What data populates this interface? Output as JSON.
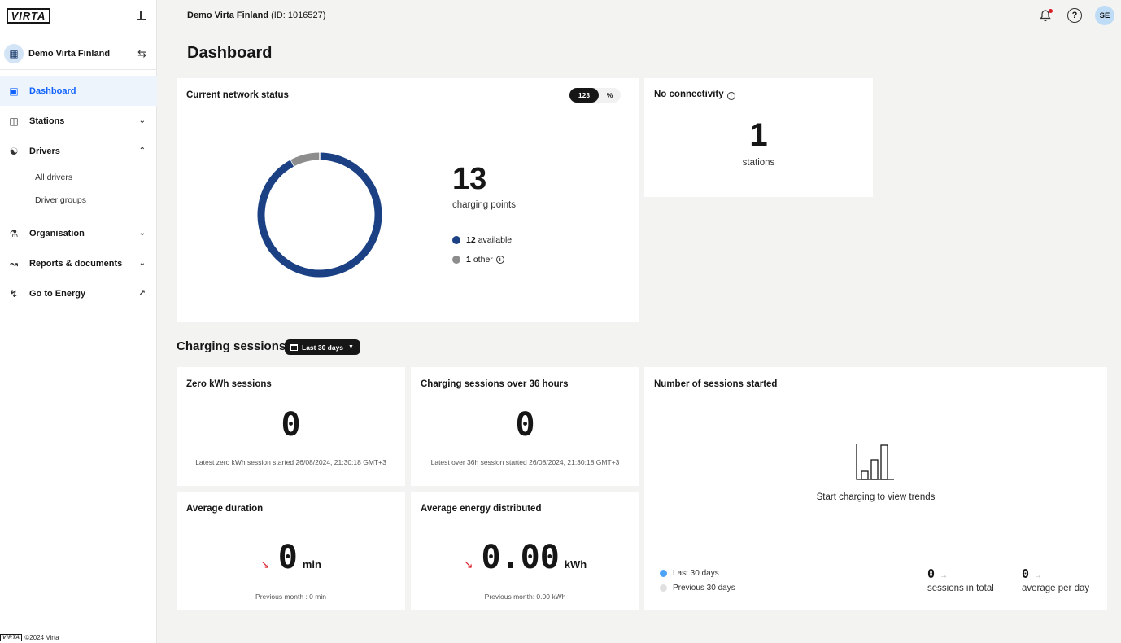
{
  "sidebar": {
    "logo_text": "VIRTA",
    "org_name": "Demo Virta Finland",
    "nav": [
      {
        "label": "Dashboard",
        "icon": "presentation-icon",
        "active": true
      },
      {
        "label": "Stations",
        "icon": "charging-station-icon"
      },
      {
        "label": "Drivers",
        "icon": "driver-icon"
      },
      {
        "label": "Organisation",
        "icon": "organisation-icon"
      },
      {
        "label": "Reports & documents",
        "icon": "chart-line-icon"
      },
      {
        "label": "Go to Energy",
        "icon": "lightning-icon"
      }
    ],
    "drivers_sub": [
      "All drivers",
      "Driver groups"
    ],
    "footer_logo": "VIRTA",
    "footer_text": "©2024 Virta"
  },
  "header": {
    "org_title": "Demo Virta Finland",
    "org_id": "(ID: 1016527)",
    "avatar_initials": "SE",
    "page_title": "Dashboard"
  },
  "network_status": {
    "title": "Current network status",
    "toggle_count": "123",
    "toggle_percent": "%",
    "total": "13",
    "total_label": "charging points",
    "available_count": "12",
    "available_label": "available",
    "other_count": "1",
    "other_label": "other",
    "available_value": 12,
    "other_value": 1,
    "available_color": "#1b4184",
    "other_color": "#8d8d8d"
  },
  "connectivity": {
    "title": "No connectivity",
    "value": "1",
    "label": "stations"
  },
  "sessions": {
    "section_title": "Charging sessions",
    "range_label": "Last 30 days",
    "zero_kwh": {
      "title": "Zero kWh sessions",
      "value": "0",
      "note": "Latest zero kWh session started 26/08/2024, 21:30:18 GMT+3"
    },
    "over_36h": {
      "title": "Charging sessions over 36 hours",
      "value": "0",
      "note": "Latest over 36h session started 26/08/2024, 21:30:18 GMT+3"
    },
    "avg_duration": {
      "title": "Average duration",
      "value": "0",
      "unit": "min",
      "previous": "Previous month : 0 min"
    },
    "avg_energy": {
      "title": "Average energy distributed",
      "value": "0.00",
      "unit": "kWh",
      "previous": "Previous month: 0.00 kWh"
    },
    "started": {
      "title": "Number of sessions started",
      "empty_text": "Start charging to view trends",
      "legend_current": "Last 30 days",
      "legend_previous": "Previous 30 days",
      "current_color": "#4da3f7",
      "previous_color": "#e0e0e0",
      "total_value": "0",
      "total_label": "sessions in total",
      "per_day_value": "0",
      "per_day_label": "average per day"
    }
  }
}
